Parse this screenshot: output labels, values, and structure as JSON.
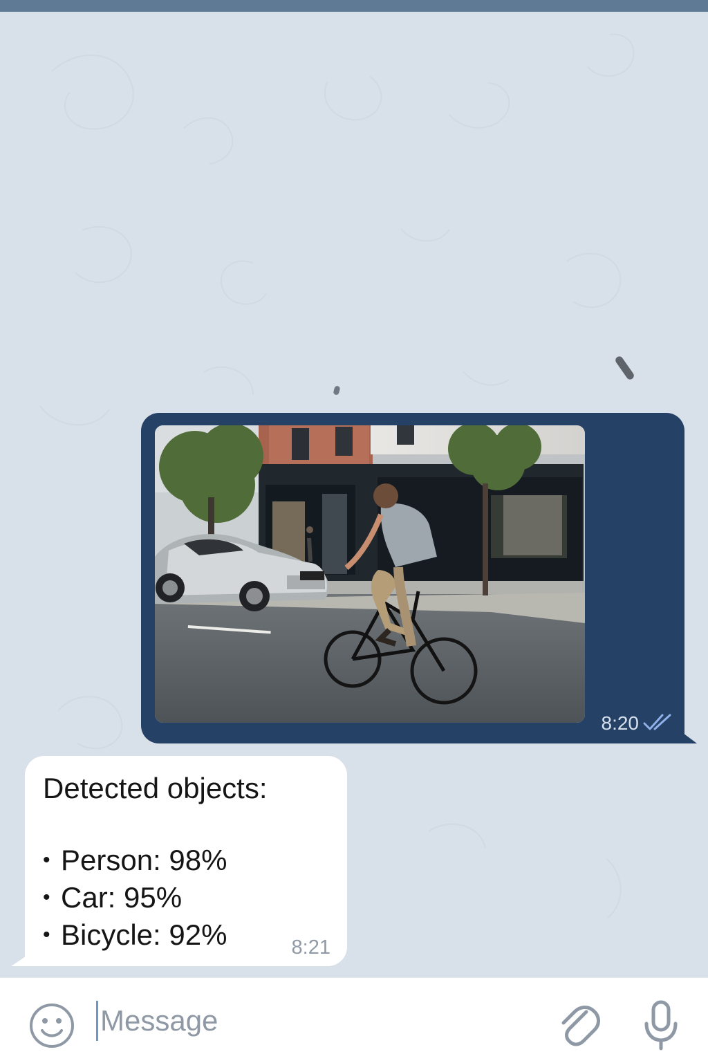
{
  "colors": {
    "top_strip": "#5e7a95",
    "chat_background": "#d8e0ea",
    "outgoing_bubble": "#264166",
    "incoming_bubble": "#ffffff",
    "composer": "#ffffff",
    "icon_gray": "#8e99a5"
  },
  "messages": {
    "outgoing": {
      "attachment_icon": "photo-icon",
      "time": "8:20",
      "status_icon": "double-check-icon"
    },
    "incoming": {
      "title": "Detected objects:",
      "items": [
        "Person: 98%",
        "Car: 95%",
        "Bicycle: 92%"
      ],
      "bullet": "•",
      "time": "8:21"
    }
  },
  "composer": {
    "placeholder": "Message",
    "value": "",
    "emoji_icon": "smiley-icon",
    "attach_icon": "paperclip-icon",
    "mic_icon": "microphone-icon"
  }
}
